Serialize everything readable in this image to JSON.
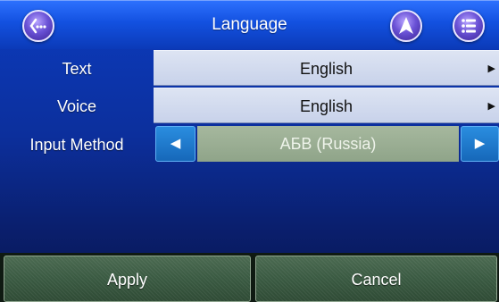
{
  "header": {
    "title": "Language",
    "back_icon_glyph": "(···"
  },
  "settings": {
    "text": {
      "label": "Text",
      "value": "English",
      "arrow": "▶"
    },
    "voice": {
      "label": "Voice",
      "value": "English",
      "arrow": "▶"
    },
    "input_method": {
      "label": "Input Method",
      "value": "АБВ (Russia)",
      "prev": "◀",
      "next": "▶"
    }
  },
  "footer": {
    "apply_label": "Apply",
    "cancel_label": "Cancel"
  },
  "colors": {
    "header_blue": "#1351e0",
    "background_blue": "#0c2f9c",
    "value_bg": "#c8d2ea",
    "input_method_value_bg": "#8fa489",
    "arrow_btn_blue": "#1668b9",
    "footer_green": "#3a5a42"
  },
  "icons": [
    "back-icon",
    "navigation-arrow-icon",
    "menu-list-icon"
  ]
}
